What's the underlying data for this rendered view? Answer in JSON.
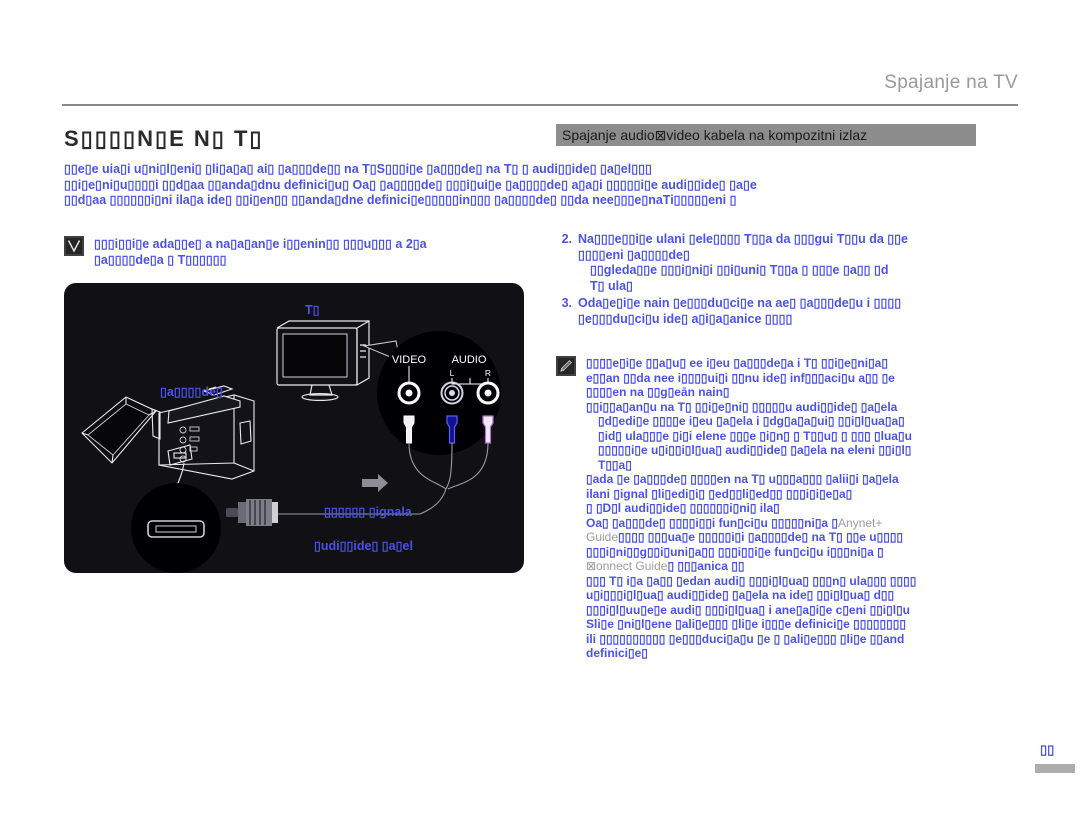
{
  "document": {
    "header_title": "Spajanje na TV",
    "section_title": "S▯▯▯▯N▯E N▯ T▯",
    "page_number": "▯▯"
  },
  "banner": {
    "label": "Spajanje audio⊠video kabela na kompozitni izlaz"
  },
  "intro": {
    "lines": [
      "▯▯e▯e uia▯i u▯ni▯l▯eni▯ ▯li▯a▯a▯ ai▯ ▯a▯▯▯de▯▯ na T▯S▯▯▯i▯e ▯a▯▯▯de▯ na T▯ ▯ audi▯▯ide▯ ▯a▯el▯▯▯",
      "▯▯i▯e▯ni▯u▯▯▯▯i ▯▯d▯aa ▯▯anda▯dnu definici▯u▯ Oa▯ ▯a▯▯▯▯de▯ ▯▯▯i▯ui▯e ▯a▯▯▯▯de▯ a▯a▯i ▯▯▯▯▯i▯e audi▯▯ide▯ ▯a▯e",
      "▯▯d▯aa ▯▯▯▯▯▯i▯ni ila▯a ide▯ ▯▯i▯en▯▯ ▯▯anda▯dne definici▯e▯▯▯▯▯in▯▯▯ ▯a▯▯▯▯de▯ ▯▯da nee▯▯▯e▯naTi▯▯▯▯▯eni ▯"
    ]
  },
  "caution": {
    "icon": "caution-icon",
    "lines": [
      "▯▯▯i▯▯i▯e ada▯▯e▯ a na▯a▯an▯e i▯▯enin▯▯ ▯▯▯u▯▯▯ a 2▯a",
      "▯a▯▯▯▯de▯a ▯ T▯▯▯▯▯▯"
    ]
  },
  "figure": {
    "labels": {
      "tv": "T▯",
      "camcorder": "▯a▯▯▯▯de▯",
      "flow": "▯▯▯▯▯▯ ▯ignala",
      "cable": "▯udi▯▯ide▯ ▯a▯el"
    },
    "jack_labels": {
      "video": "VIDEO",
      "audio": "AUDIO",
      "left": "L",
      "right": "R"
    }
  },
  "steps": [
    {
      "number": "2.",
      "lines": [
        "Na▯▯▯e▯▯i▯e ulani ▯ele▯▯▯▯ T▯▯a da ▯▯▯gui T▯▯u da ▯▯e",
        "▯▯▯▯eni ▯a▯▯▯▯de▯"
      ],
      "sub": [
        "▯▯gleda▯▯e ▯▯▯i▯ni▯i ▯▯i▯uni▯ T▯▯a ▯ ▯▯▯e ▯a▯▯ ▯d",
        "T▯ ula▯"
      ]
    },
    {
      "number": "3.",
      "lines": [
        "Oda▯e▯i▯e nain ▯e▯▯▯du▯ci▯e na ae▯ ▯a▯▯▯de▯u i ▯▯▯▯",
        "▯e▯▯▯du▯ci▯u ide▯ a▯i▯a▯anice ▯▯▯▯"
      ]
    }
  ],
  "note": {
    "icon": "note-icon",
    "lines": [
      "▯▯▯▯e▯i▯e ▯▯a▯u▯ ee i▯eu ▯a▯▯▯de▯a i T▯ ▯▯i▯e▯ni▯a▯",
      "e▯▯an ▯▯da nee i▯▯▯▯ui▯i ▯▯nu ide▯ inf▯▯▯aci▯u a▯▯ ▯e",
      "▯▯▯▯en na ▯▯g▯eān nain▯",
      "▯▯i▯▯a▯an▯u na T▯ ▯▯i▯e▯ni▯ ▯▯▯▯▯u audi▯▯ide▯ ▯a▯elа",
      "▯d▯edi▯e ▯▯▯▯e i▯eu ▯a▯ela i ▯dg▯a▯a▯ui▯ ▯▯i▯l▯ua▯a▯",
      "▯id▯ ula▯▯▯e ▯i▯i elene ▯▯▯e ▯i▯n▯ ▯ T▯▯u▯ ▯ ▯▯▯ ▯lua▯u",
      "▯▯▯▯▯i▯e u▯i▯▯i▯l▯ua▯ audi▯▯ide▯ ▯a▯ela na eleni ▯▯i▯l▯",
      "T▯▯a▯",
      "▯ada ▯e ▯a▯▯▯de▯ ▯▯▯▯en na T▯ u▯▯▯a▯▯▯ ▯alii▯i ▯a▯elа",
      "ilani ▯ignal ▯li▯edi▯i▯ ▯ed▯▯li▯ed▯▯ ▯▯▯i▯i▯e▯a▯",
      "▯ ▯D▯l audi▯▯ide▯ ▯▯▯▯▯▯i▯ni▯ ila▯",
      "Oa▯ ▯a▯▯▯de▯ ▯▯▯▯i▯▯i fun▯ci▯u ▯▯▯▯▯ni▯a ▯",
      "▯▯▯i▯ni▯▯g▯▯i▯uni▯a▯▯ ▯▯▯i▯▯i▯e fun▯ci▯u i▯▯▯ni▯a ▯",
      "▯▯▯ T▯ i▯a ▯a▯▯ ▯edan audi▯ ▯▯▯i▯l▯ua▯ ▯▯▯n▯ ula▯▯▯ ▯▯▯▯",
      "u▯i▯▯▯i▯l▯ua▯ audi▯▯ide▯ ▯a▯ela na ide▯ ▯▯i▯l▯ua▯ d▯▯",
      "▯▯▯i▯l▯uu▯e▯e audi▯ ▯▯▯i▯l▯ua▯ i ane▯a▯i▯e c▯eni ▯▯i▯l▯u",
      "Sli▯e ▯ni▯l▯ene ▯ali▯e▯▯▯ ▯li▯e i▯▯▯e definici▯e ▯▯▯▯▯▯▯▯",
      "ili ▯▯▯▯▯▯▯▯▯▯ ▯e▯▯▯duci▯a▯u ▯e ▯ ▯ali▯e▯▯▯ ▯li▯e ▯▯and",
      "definici▯e▯"
    ],
    "gray_tokens": {
      "anynet": "Anynet+",
      "guide_1": "Guide",
      "connect_guide": "⊠onnect Guide",
      "suffix_1": "▯▯▯▯ ▯▯▯ua▯e ▯▯▯▯▯i▯i ▯a▯▯▯▯de▯ na T▯ ▯▯e u▯▯▯▯",
      "suffix_2": "▯ ▯▯▯anica ▯▯"
    }
  }
}
